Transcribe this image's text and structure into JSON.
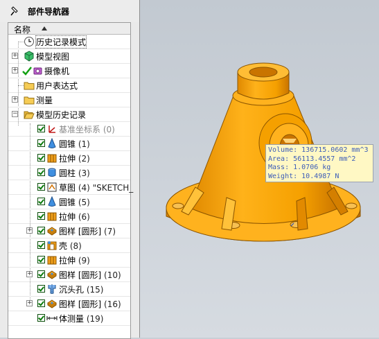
{
  "navigator": {
    "title": "部件导航器",
    "column_header": "名称",
    "items": [
      {
        "label": "历史记录模式",
        "icon": "clock-icon"
      },
      {
        "label": "模型视图",
        "icon": "model-view-icon"
      },
      {
        "label": "摄像机",
        "icon": "camera-icon"
      },
      {
        "label": "用户表达式",
        "icon": "folder-icon"
      },
      {
        "label": "测量",
        "icon": "folder-icon"
      },
      {
        "label": "模型历史记录",
        "icon": "folder-open-icon"
      }
    ],
    "features": [
      {
        "name": "基准坐标系",
        "num": "(0)",
        "icon": "datum-csys-icon"
      },
      {
        "name": "圆锥",
        "num": "(1)",
        "icon": "cone-icon"
      },
      {
        "name": "拉伸",
        "num": "(2)",
        "icon": "extrude-icon"
      },
      {
        "name": "圆柱",
        "num": "(3)",
        "icon": "cylinder-icon"
      },
      {
        "name": "草图",
        "num": "(4) \"SKETCH_",
        "icon": "sketch-icon"
      },
      {
        "name": "圆锥",
        "num": "(5)",
        "icon": "cone-icon"
      },
      {
        "name": "拉伸",
        "num": "(6)",
        "icon": "extrude-icon"
      },
      {
        "name": "图样 [圆形]",
        "num": "(7)",
        "icon": "pattern-icon"
      },
      {
        "name": "壳",
        "num": "(8)",
        "icon": "shell-icon"
      },
      {
        "name": "拉伸",
        "num": "(9)",
        "icon": "extrude-icon"
      },
      {
        "name": "图样 [圆形]",
        "num": "(10)",
        "icon": "pattern-icon"
      },
      {
        "name": "沉头孔",
        "num": "(15)",
        "icon": "counterbore-hole-icon"
      },
      {
        "name": "图样 [圆形]",
        "num": "(16)",
        "icon": "pattern-icon"
      },
      {
        "name": "体测量",
        "num": "(19)",
        "icon": "measure-body-icon"
      }
    ]
  },
  "measurement": {
    "volume": "Volume: 136715.0602 mm^3",
    "area": "Area: 56113.4557 mm^2",
    "mass": "Mass: 1.0706 kg",
    "weight": "Weight: 10.4987 N"
  },
  "colors": {
    "part_orange": "#f5a000",
    "part_shadow": "#d17e00",
    "tooltip_bg": "#fff8c4",
    "tooltip_text": "#3b5cb8",
    "check_green": "#0a7a0a"
  }
}
